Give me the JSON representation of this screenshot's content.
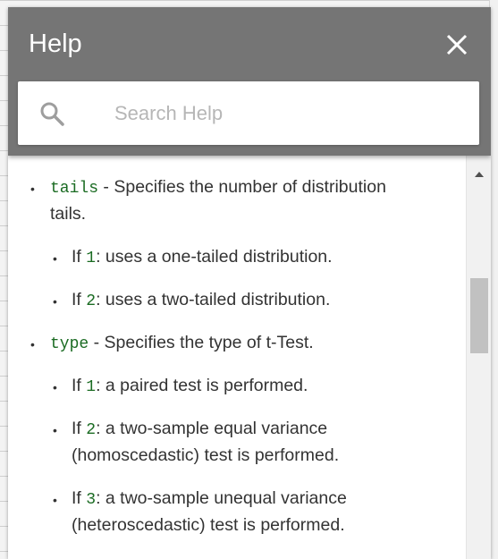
{
  "help": {
    "title": "Help",
    "close_icon": "close-icon",
    "search": {
      "placeholder": "Search Help",
      "value": ""
    }
  },
  "content": {
    "tails": {
      "param": "tails",
      "description": " - Specifies the number of distribution",
      "description_cont": "tails.",
      "options": [
        {
          "prefix": "If ",
          "value": "1",
          "text": ": uses a one-tailed distribution."
        },
        {
          "prefix": "If ",
          "value": "2",
          "text": ": uses a two-tailed distribution."
        }
      ]
    },
    "type": {
      "param": "type",
      "description": " - Specifies the type of t-Test.",
      "options": [
        {
          "prefix": "If ",
          "value": "1",
          "text": ": a paired test is performed.",
          "text_cont": ""
        },
        {
          "prefix": "If ",
          "value": "2",
          "text": ": a two-sample equal variance",
          "text_cont": "(homoscedastic) test is performed."
        },
        {
          "prefix": "If ",
          "value": "3",
          "text": ": a two-sample unequal variance",
          "text_cont": "(heteroscedastic) test is performed."
        }
      ]
    }
  },
  "colors": {
    "header": "#757575",
    "code": "#1a6b22",
    "text": "#333333"
  }
}
